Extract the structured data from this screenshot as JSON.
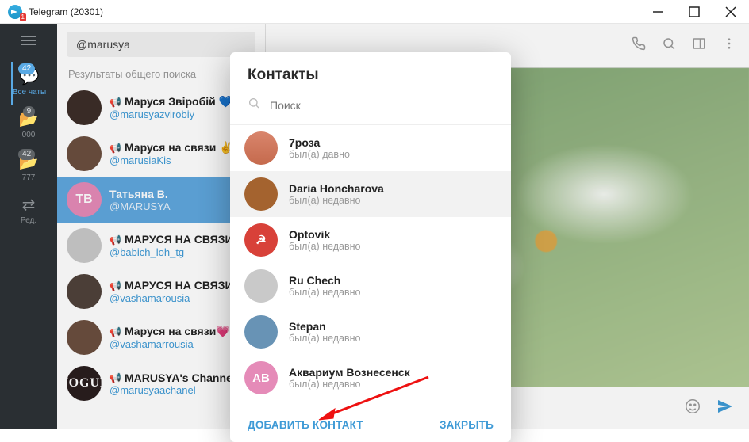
{
  "window": {
    "title": "Telegram (20301)",
    "badge": "1"
  },
  "rail": {
    "items": [
      {
        "label": "Все чаты",
        "badge": "42",
        "icon": "💬",
        "active": true
      },
      {
        "label": "000",
        "badge": "9",
        "icon": "📂",
        "active": false
      },
      {
        "label": "777",
        "badge": "42",
        "icon": "📂",
        "active": false
      },
      {
        "label": "Ред.",
        "badge": "",
        "icon": "⇄",
        "active": false
      }
    ]
  },
  "search": {
    "value": "@marusya"
  },
  "results_header": "Результаты общего поиска",
  "chats": [
    {
      "name": "Маруся Звіробій 💙",
      "handle": "@marusyazvirobiy",
      "avatar_class": "av-dk1",
      "megaphone": true
    },
    {
      "name": "Маруся на связи ✌️",
      "handle": "@marusiaKis",
      "avatar_class": "av-dk2",
      "megaphone": true
    },
    {
      "name": "Татьяна В.",
      "handle": "@MARUSYA",
      "avatar_class": "av-pink",
      "avatar_text": "ТВ",
      "megaphone": false,
      "selected": true
    },
    {
      "name": "МАРУСЯ НА СВЯЗИ 😉",
      "handle": "@babich_loh_tg",
      "avatar_class": "av-grey",
      "megaphone": true
    },
    {
      "name": "МАРУСЯ НА СВЯЗИ ✌️",
      "handle": "@vashamarousia",
      "avatar_class": "av-dk3",
      "megaphone": true
    },
    {
      "name": "Маруся на связи💗",
      "handle": "@vashamarrousia",
      "avatar_class": "av-dk2",
      "megaphone": true
    },
    {
      "name": "MARUSYA's Channel",
      "handle": "@marusyaachanel",
      "avatar_class": "av-vog",
      "avatar_text": "VOGUE",
      "megaphone": true
    }
  ],
  "modal": {
    "title": "Контакты",
    "search_placeholder": "Поиск",
    "add_label": "ДОБАВИТЬ КОНТАКТ",
    "close_label": "ЗАКРЫТЬ",
    "contacts": [
      {
        "name": "7роза",
        "status": "был(а) давно",
        "avatar_class": "av-brick",
        "avatar_text": "",
        "hover": false
      },
      {
        "name": "Daria Honcharova",
        "status": "был(а) недавно",
        "avatar_class": "av-orange1",
        "avatar_text": "",
        "hover": true
      },
      {
        "name": "Optovik",
        "status": "был(а) недавно",
        "avatar_class": "av-red",
        "avatar_text": "☭",
        "hover": false
      },
      {
        "name": "Ru Chech",
        "status": "был(а) недавно",
        "avatar_class": "av-grey",
        "avatar_text": "",
        "hover": false
      },
      {
        "name": "Stepan",
        "status": "был(а) недавно",
        "avatar_class": "av-blue",
        "avatar_text": "",
        "hover": false
      },
      {
        "name": "Аквариум Вознесенск",
        "status": "был(а) недавно",
        "avatar_class": "av-pink",
        "avatar_text": "АВ",
        "hover": false
      }
    ]
  }
}
